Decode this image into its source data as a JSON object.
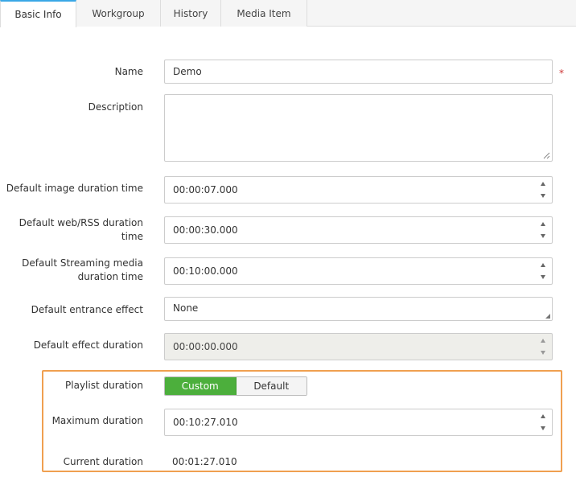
{
  "tabs": [
    {
      "label": "Basic Info",
      "active": true
    },
    {
      "label": "Workgroup",
      "active": false
    },
    {
      "label": "History",
      "active": false
    },
    {
      "label": "Media Item",
      "active": false
    }
  ],
  "form": {
    "name": {
      "label": "Name",
      "value": "Demo",
      "required_mark": "*"
    },
    "description": {
      "label": "Description",
      "value": ""
    },
    "image_duration": {
      "label": "Default image duration time",
      "value": "00:00:07.000"
    },
    "web_duration": {
      "label": "Default web/RSS duration time",
      "value": "00:00:30.000"
    },
    "streaming_duration": {
      "label": "Default Streaming media duration time",
      "value": "00:10:00.000"
    },
    "entrance_effect": {
      "label": "Default entrance effect",
      "value": "None"
    },
    "effect_duration": {
      "label": "Default effect duration",
      "value": "00:00:00.000"
    },
    "playlist_duration": {
      "label": "Playlist duration",
      "options": [
        "Custom",
        "Default"
      ],
      "selected": "Custom"
    },
    "max_duration": {
      "label": "Maximum duration",
      "value": "00:10:27.010"
    },
    "current_duration": {
      "label": "Current duration",
      "value": "00:01:27.010"
    }
  },
  "colors": {
    "accent_tab": "#3aa8e6",
    "toggle_on": "#4caf3c",
    "highlight_border": "#f0a050",
    "required": "#cc3333"
  }
}
